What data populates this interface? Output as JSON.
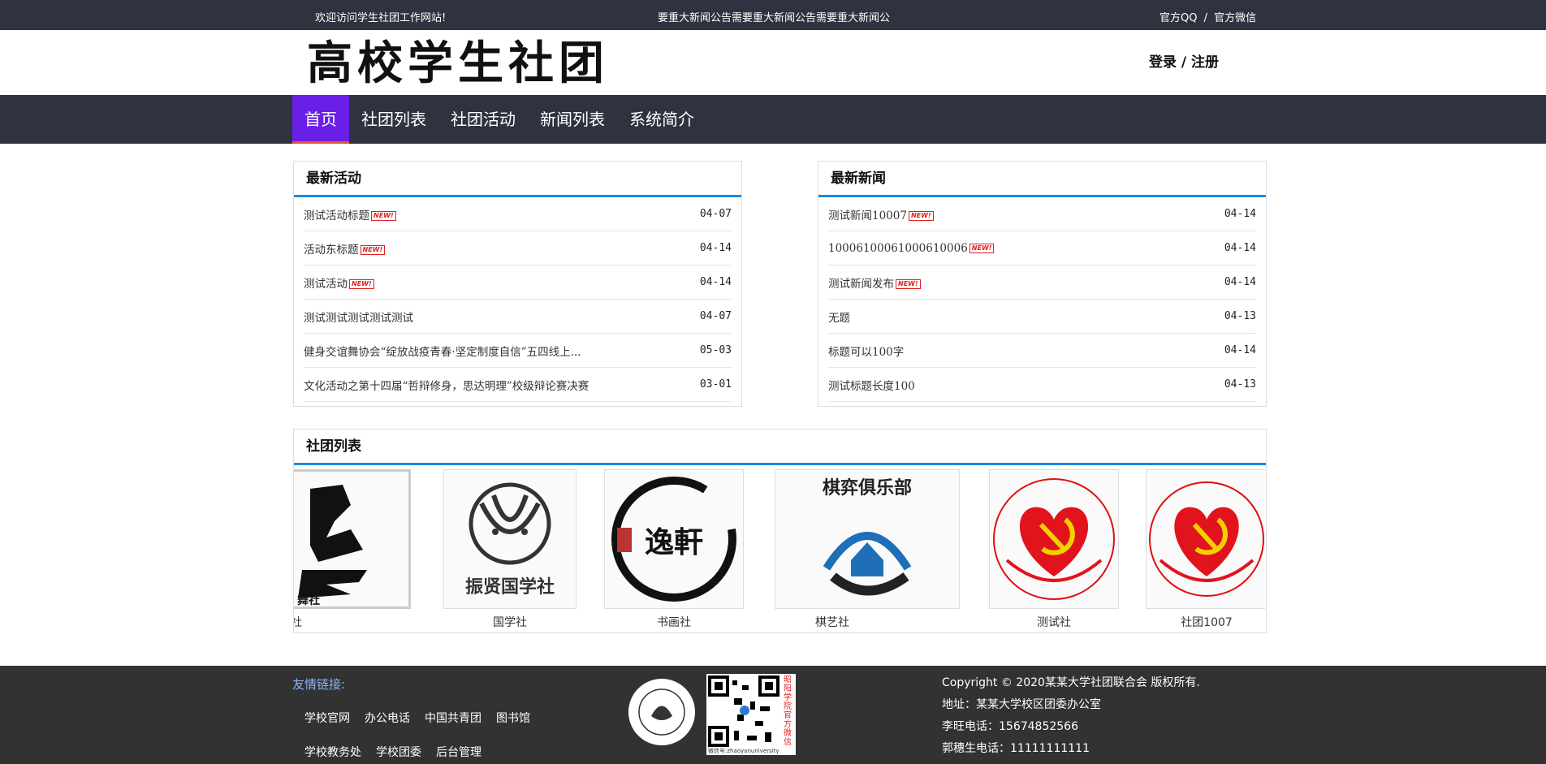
{
  "topbar": {
    "welcome": "欢迎访问学生社团工作网站!",
    "marquee": "要重大新闻公告需要重大新闻公告需要重大新闻公",
    "qq": "官方QQ",
    "sep": "/",
    "wechat": "官方微信"
  },
  "header": {
    "logo": "高校学生社团",
    "login": "登录 / 注册"
  },
  "nav": {
    "items": [
      "首页",
      "社团列表",
      "社团活动",
      "新闻列表",
      "系统简介"
    ]
  },
  "activities": {
    "title": "最新活动",
    "badge": "NEW!",
    "items": [
      {
        "title": "测试活动标题",
        "date": "04-07",
        "new": true
      },
      {
        "title": "活动东标题",
        "date": "04-14",
        "new": true
      },
      {
        "title": "测试活动",
        "date": "04-14",
        "new": true
      },
      {
        "title": "测试测试测试测试测试",
        "date": "04-07",
        "new": false
      },
      {
        "title": "健身交谊舞协会“绽放战疫青春·坚定制度自信”五四线上...",
        "date": "05-03",
        "new": false
      },
      {
        "title": "文化活动之第十四届“哲辩修身，思达明理”校级辩论赛决赛",
        "date": "03-01",
        "new": false
      }
    ]
  },
  "news": {
    "title": "最新新闻",
    "items": [
      {
        "title": "测试新闻10007",
        "date": "04-14",
        "new": true
      },
      {
        "title": "1000610006100061000​6",
        "date": "04-14",
        "new": true
      },
      {
        "title": "测试新闻发布",
        "date": "04-14",
        "new": true
      },
      {
        "title": "无题",
        "date": "04-13",
        "new": false
      },
      {
        "title": "标题可以100字",
        "date": "04-14",
        "new": false
      },
      {
        "title": "测试标题长度100",
        "date": "04-13",
        "new": false
      }
    ]
  },
  "clubs": {
    "title": "社团列表",
    "items": [
      {
        "name": "社",
        "logo": "舞社"
      },
      {
        "name": "国学社",
        "logo": "振贤国学社"
      },
      {
        "name": "书画社",
        "logo": "逸軒"
      },
      {
        "name": "棋艺社",
        "logo": "棋弈俱乐部"
      },
      {
        "name": "测试社",
        "logo": "emblem"
      },
      {
        "name": "社团1007",
        "logo": "emblem"
      }
    ]
  },
  "footer": {
    "friend_label": "友情链接:",
    "links_row1": [
      "学校官网",
      "办公电话",
      "中国共青团",
      "图书馆"
    ],
    "links_row2": [
      "学校教务处",
      "学校团委",
      "后台管理"
    ],
    "qr_caption": "微信号:zhaoyanuniversity",
    "qr_side": "昭阳学院官方微信",
    "copyright": "Copyright © 2020某某大学社团联合会 版权所有.",
    "address": "地址：某某大学校区团委办公室",
    "phone1": "李旺电话：15674852566",
    "phone2": "郭穗生电话：11111111111",
    "colors": {
      "accent": "#1a8be3",
      "nav_active": "#6b1ee6",
      "dark": "#2f3340"
    }
  }
}
